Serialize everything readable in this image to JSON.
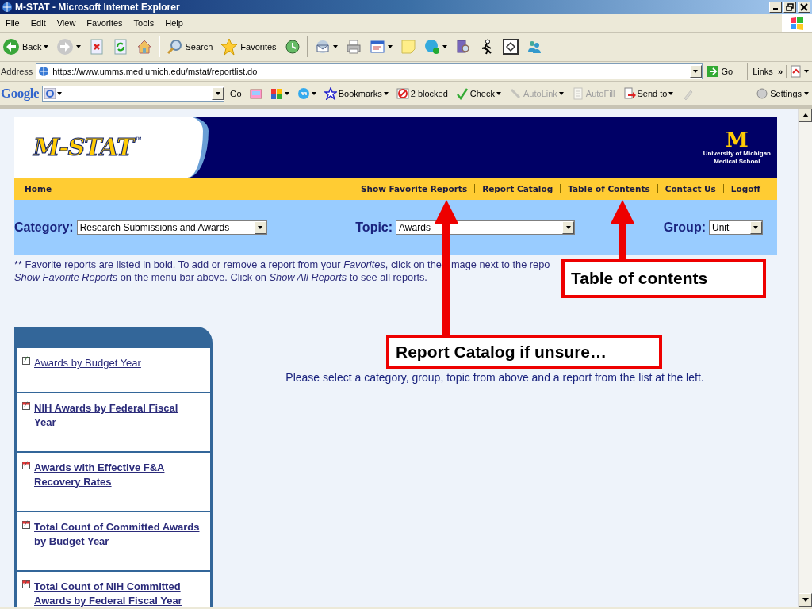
{
  "window": {
    "title": "M-STAT - Microsoft Internet Explorer"
  },
  "menu": [
    "File",
    "Edit",
    "View",
    "Favorites",
    "Tools",
    "Help"
  ],
  "toolbar": [
    {
      "kind": "back",
      "label": "Back",
      "caret": true
    },
    {
      "kind": "forward",
      "caret": true
    },
    {
      "kind": "stop",
      "caret": false
    },
    {
      "kind": "refresh",
      "caret": false
    },
    {
      "kind": "home",
      "caret": false
    },
    {
      "kind": "search",
      "label": "Search",
      "caret": false
    },
    {
      "kind": "favorites",
      "label": "Favorites",
      "caret": false
    },
    {
      "kind": "history",
      "caret": false
    },
    {
      "kind": "mail",
      "caret": true
    },
    {
      "kind": "print",
      "caret": false
    },
    {
      "kind": "edit",
      "caret": true
    },
    {
      "kind": "note",
      "caret": false
    },
    {
      "kind": "phone",
      "caret": true
    },
    {
      "kind": "research",
      "caret": false
    },
    {
      "kind": "runner",
      "caret": false
    },
    {
      "kind": "frame",
      "caret": false
    },
    {
      "kind": "people",
      "caret": false
    }
  ],
  "address": {
    "label": "Address",
    "url": "https://www.umms.med.umich.edu/mstat/reportlist.do",
    "go": "Go",
    "links": "Links",
    "more": "»"
  },
  "google_bar": {
    "logo": "Google",
    "items": [
      {
        "kind": "go",
        "label": "Go",
        "caret": false,
        "disabled": false
      },
      {
        "kind": "pager",
        "caret": false,
        "disabled": false
      },
      {
        "kind": "puzzle",
        "caret": true,
        "disabled": false
      },
      {
        "kind": "bubble",
        "caret": true,
        "disabled": false
      },
      {
        "kind": "star",
        "label": "Bookmarks",
        "caret": true,
        "disabled": false
      },
      {
        "kind": "blocked",
        "label": "2 blocked",
        "caret": false,
        "disabled": false
      },
      {
        "kind": "check",
        "label": "Check",
        "caret": true,
        "disabled": false
      },
      {
        "kind": "wand",
        "label": "AutoLink",
        "caret": true,
        "disabled": true
      },
      {
        "kind": "form",
        "label": "AutoFill",
        "caret": false,
        "disabled": true
      },
      {
        "kind": "send",
        "label": "Send to",
        "caret": true,
        "disabled": false
      },
      {
        "kind": "pen",
        "caret": false,
        "disabled": true
      }
    ],
    "settings": "Settings"
  },
  "site": {
    "logo": "M-STAT",
    "trademark": "™",
    "university_mark": "M",
    "university": [
      "University of Michigan",
      "Medical School"
    ]
  },
  "nav": [
    "Home",
    "Show Favorite Reports",
    "Report Catalog",
    "Table of Contents",
    "Contact Us",
    "Logoff"
  ],
  "filters": [
    {
      "label": "Category:",
      "value": "Research Submissions and Awards"
    },
    {
      "label": "Topic:",
      "value": "Awards"
    },
    {
      "label": "Group:",
      "value": "Unit"
    }
  ],
  "note": {
    "line_1_parts": [
      "** Favorite reports are listed in bold. To add or remove a report from your *Favorites*, click on the",
      "mage next to the repo"
    ],
    "line_2": "*Show Favorite Reports* on the menu bar above. Click on *Show All Reports* to see all reports."
  },
  "reports": [
    {
      "title": "Awards by Budget Year",
      "favorite": false
    },
    {
      "title": "NIH Awards by Federal Fiscal Year",
      "favorite": true
    },
    {
      "title": "Awards with Effective F&A Recovery Rates",
      "favorite": true
    },
    {
      "title": "Total Count of Committed Awards by Budget Year",
      "favorite": true
    },
    {
      "title": "Total Count of NIH Committed Awards by Federal Fiscal Year",
      "favorite": true
    }
  ],
  "message": "Please select a category, group, topic from above and a report from the list at the left.",
  "callouts": [
    "Table of contents",
    "Report Catalog if unsure…"
  ]
}
